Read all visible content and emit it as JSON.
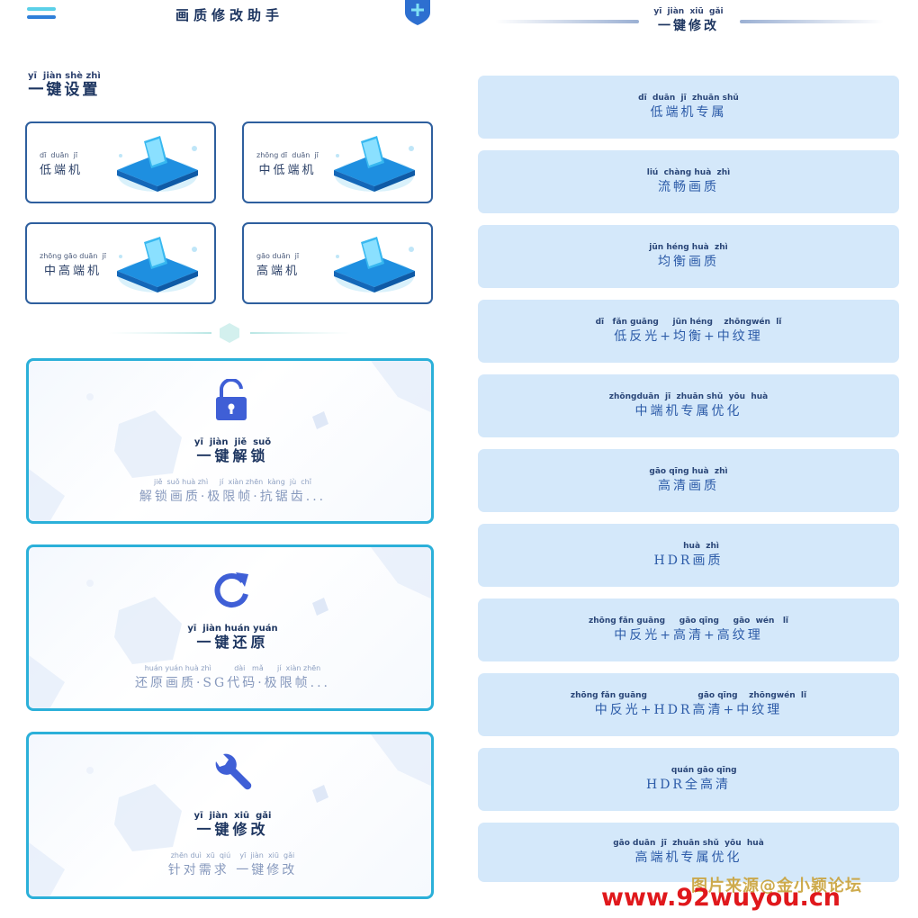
{
  "header": {
    "app_title": "画质修改助手"
  },
  "settings": {
    "heading_pinyin": "yī  jiàn shè zhì",
    "heading": "一键设置",
    "device_cards": [
      {
        "pinyin": "dī  duān  jī",
        "label": "低端机"
      },
      {
        "pinyin": "zhōng dī  duān  jī",
        "label": "中低端机"
      },
      {
        "pinyin": "zhōng gāo duān  jī",
        "label": "中高端机"
      },
      {
        "pinyin": "gāo duān  jī",
        "label": "高端机"
      }
    ]
  },
  "actions": [
    {
      "title_pinyin": "yī  jiàn  jiě  suǒ",
      "title": "一键解锁",
      "sub_pinyin": "jiě  suǒ huà zhì     jí  xiàn zhēn  kàng  jù  chǐ",
      "subtitle": "解锁画质·极限帧·抗锯齿...",
      "icon": "unlock-icon"
    },
    {
      "title_pinyin": "yī  jiàn huán yuán",
      "title": "一键还原",
      "sub_pinyin": "huán yuán huà zhì          dài   mǎ      jí  xiàn zhēn",
      "subtitle": "还原画质·SG代码·极限帧...",
      "icon": "refresh-icon"
    },
    {
      "title_pinyin": "yī  jiàn  xiū  gǎi",
      "title": "一键修改",
      "sub_pinyin": "zhēn duì  xū  qiú    yī  jiàn  xiū  gǎi",
      "subtitle": "针对需求 一键修改",
      "icon": "wrench-icon"
    }
  ],
  "modify": {
    "heading_pinyin": "yī  jiàn  xiū  gǎi",
    "heading": "一键修改",
    "presets": [
      {
        "pinyin": "dī  duān  jī  zhuān shǔ",
        "label": "低端机专属"
      },
      {
        "pinyin": "liú  chàng huà  zhì",
        "label": "流畅画质"
      },
      {
        "pinyin": "jūn héng huà  zhì",
        "label": "均衡画质"
      },
      {
        "pinyin": "dī   fǎn guāng     jūn héng    zhōngwén  lǐ",
        "label": "低反光+均衡+中纹理"
      },
      {
        "pinyin": "zhōngduān  jī  zhuān shǔ  yōu  huà",
        "label": "中端机专属优化"
      },
      {
        "pinyin": "gāo qīng huà  zhì",
        "label": "高清画质"
      },
      {
        "pinyin": "         huà  zhì",
        "label": "HDR画质"
      },
      {
        "pinyin": "zhōng fǎn guāng     gāo qīng     gāo  wén   lǐ",
        "label": "中反光+高清+高纹理"
      },
      {
        "pinyin": "zhōng fǎn guāng                  gāo qīng    zhōngwén  lǐ",
        "label": "中反光+HDR高清+中纹理"
      },
      {
        "pinyin": "           quán gāo qīng",
        "label": "HDR全高清"
      },
      {
        "pinyin": "gāo duān  jī  zhuān shǔ  yōu  huà",
        "label": "高端机专属优化"
      }
    ]
  },
  "watermark": {
    "line1": "图片来源@金小颖论坛",
    "line2": "www.92wuyou.cn"
  },
  "colors": {
    "accent": "#2bb0d9",
    "card_border": "#2e5f9e",
    "preset_bg": "#d4e8fa",
    "icon_blue": "#3f5fd6",
    "watermark_red": "#e0181c"
  }
}
